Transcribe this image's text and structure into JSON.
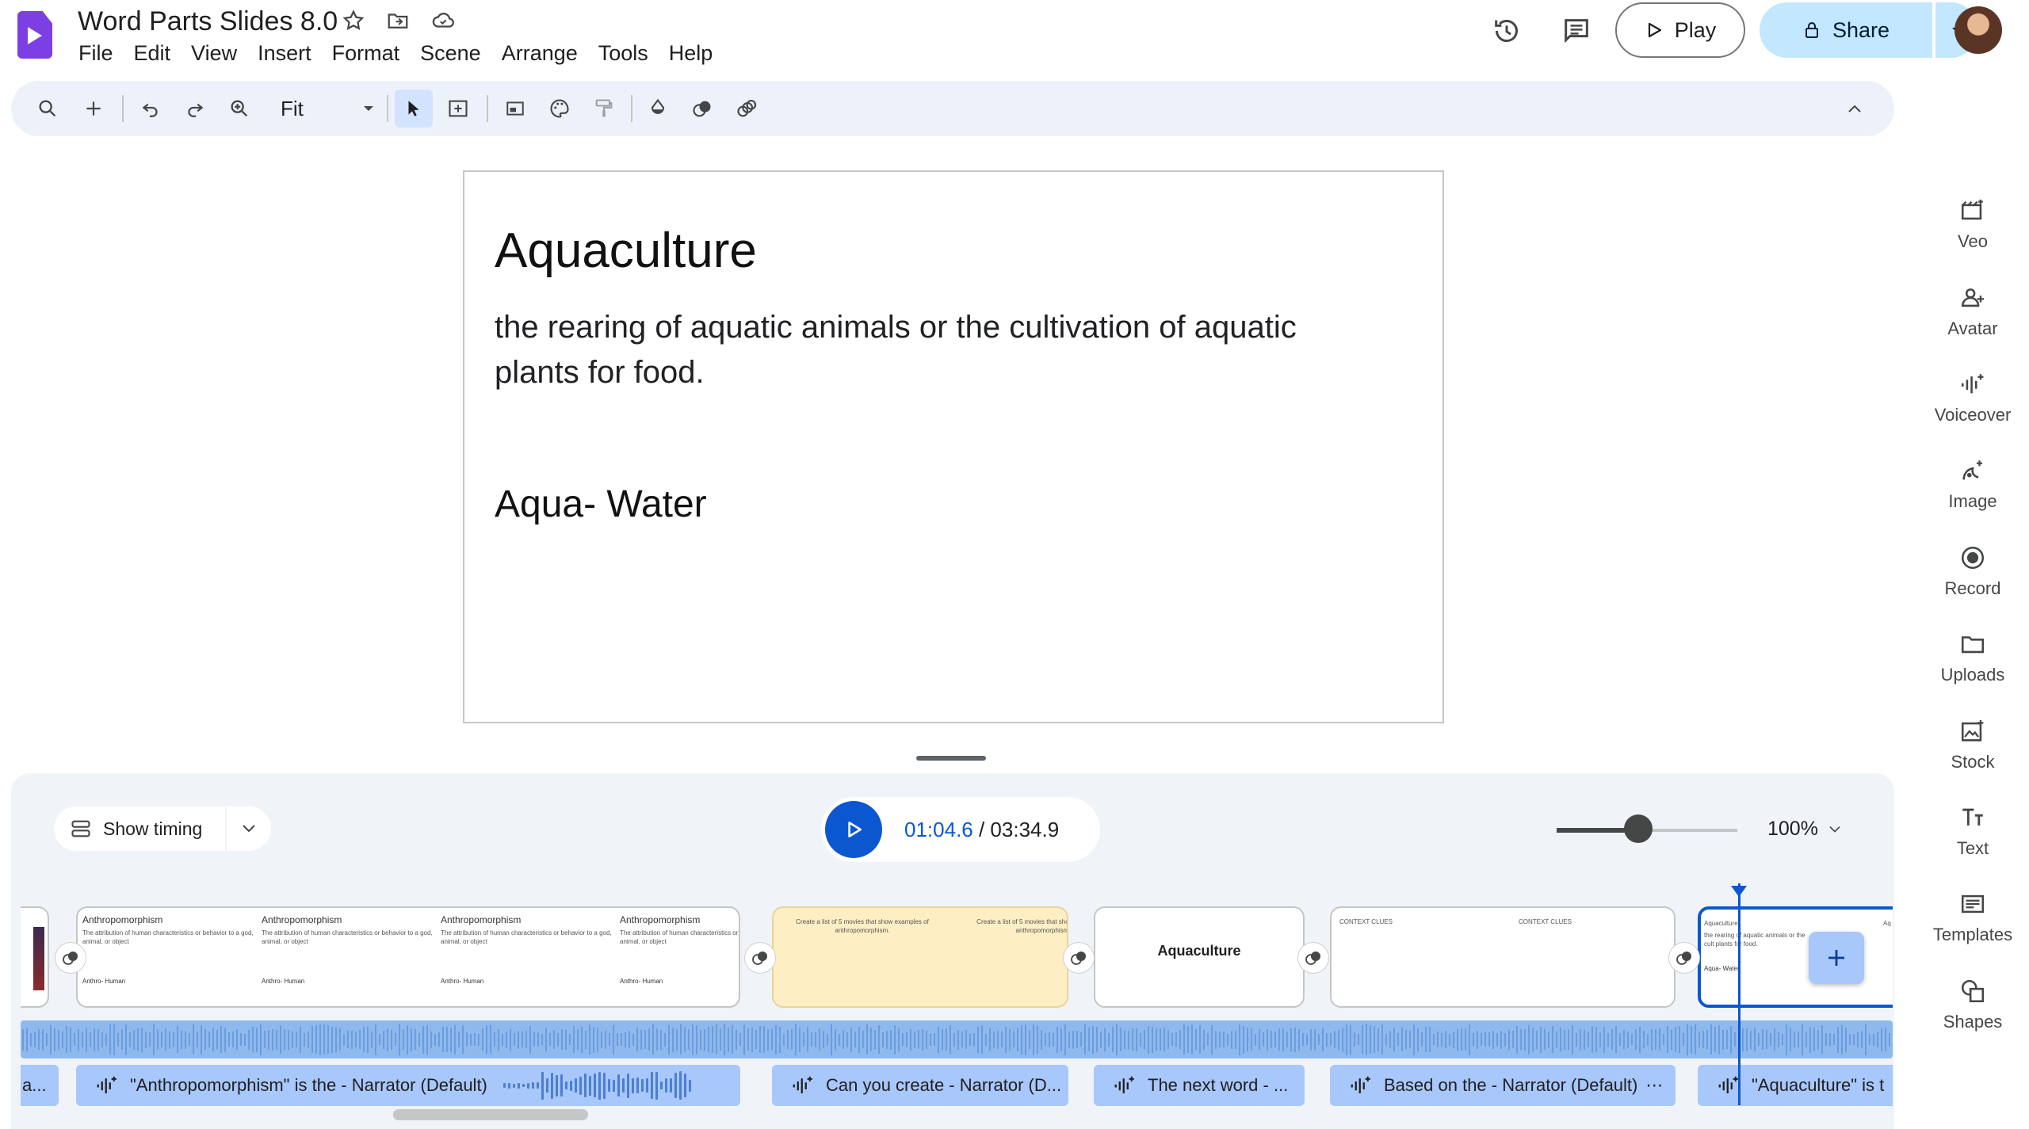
{
  "app": {
    "doc_title": "Word Parts Slides 8.0",
    "menus": [
      "File",
      "Edit",
      "View",
      "Insert",
      "Format",
      "Scene",
      "Arrange",
      "Tools",
      "Help"
    ]
  },
  "header": {
    "play_label": "Play",
    "share_label": "Share"
  },
  "toolbar": {
    "zoom_value": "Fit"
  },
  "slide": {
    "title": "Aquaculture",
    "body": "the rearing of aquatic animals or the cultivation of aquatic plants for food.",
    "subtitle": "Aqua- Water"
  },
  "side_panel": {
    "items": [
      {
        "label": "Veo",
        "icon": "veo-icon"
      },
      {
        "label": "Avatar",
        "icon": "avatar-icon"
      },
      {
        "label": "Voiceover",
        "icon": "voiceover-icon"
      },
      {
        "label": "Image",
        "icon": "image-icon"
      },
      {
        "label": "Record",
        "icon": "record-icon"
      },
      {
        "label": "Uploads",
        "icon": "uploads-icon"
      },
      {
        "label": "Stock",
        "icon": "stock-icon"
      },
      {
        "label": "Text",
        "icon": "text-icon"
      },
      {
        "label": "Templates",
        "icon": "templates-icon"
      },
      {
        "label": "Shapes",
        "icon": "shapes-icon"
      }
    ]
  },
  "timeline": {
    "show_timing_label": "Show timing",
    "current_time": "01:04.6",
    "total_time": "/ 03:34.9",
    "zoom_percent": "100%",
    "zoom_level": 0.45,
    "scenes": {
      "anthro_title": "Anthropomorphism",
      "anthro_desc": "The attribution of human characteristics or behavior to a god, animal, or object",
      "anthro_word": "Anthro- Human",
      "movies_text": "Create a list of 5 movies that show examples of anthropomorphism.",
      "aquaculture_title": "Aquaculture",
      "context_clues": "CONTEXT CLUES",
      "aqua_thumb_title": "Aquaculture",
      "aqua_thumb_desc": "the rearing of aquatic animals or the cult plants for food.",
      "aqua_thumb_word": "Aqua- Water",
      "aq_partial": "Aq"
    },
    "voiceovers": [
      {
        "text": "a..."
      },
      {
        "text": "\"Anthropomorphism\" is the - Narrator (Default)"
      },
      {
        "text": "Can you create - Narrator (D..."
      },
      {
        "text": "The next word - ..."
      },
      {
        "text": "Based on the - Narrator (Default)"
      },
      {
        "text": "\"Aquaculture\" is t"
      }
    ]
  },
  "colors": {
    "accent": "#0b57d0",
    "share_bg": "#c2e7ff",
    "toolbar_bg": "#edf2fa",
    "logo": "#7b3fe4"
  }
}
